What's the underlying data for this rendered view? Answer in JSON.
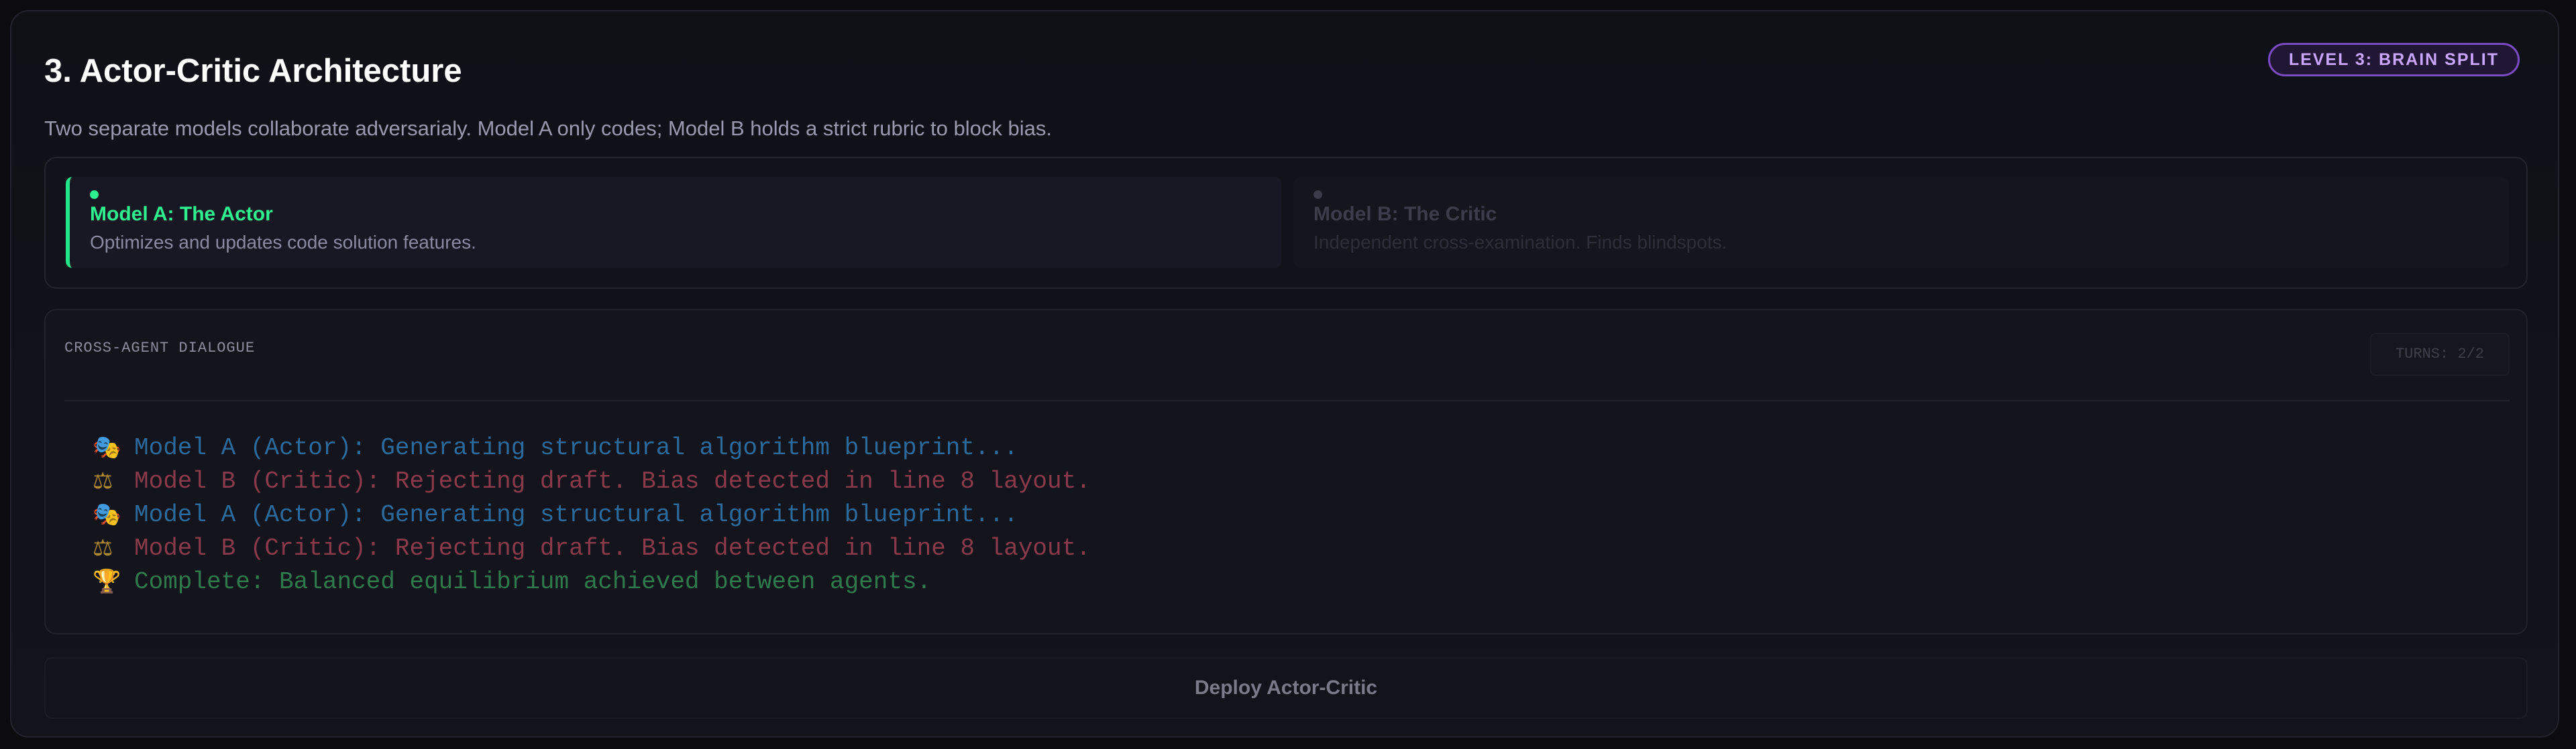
{
  "header": {
    "title": "3. Actor-Critic Architecture",
    "level_badge": "LEVEL 3: BRAIN SPLIT",
    "subtitle": "Two separate models collaborate adversarialy. Model A only codes; Model B holds a strict rubric to block bias."
  },
  "models": [
    {
      "name": "Model A: The Actor",
      "description": "Optimizes and updates code solution features.",
      "status": "active",
      "accent": "#2ef08f"
    },
    {
      "name": "Model B: The Critic",
      "description": "Independent cross-examination. Finds blindspots.",
      "status": "inactive",
      "accent": "#3a3a48"
    }
  ],
  "dialogue": {
    "label": "CROSS-AGENT DIALOGUE",
    "turns": "TURNS: 2/2",
    "lines": [
      {
        "icon": "🎭",
        "icon_name": "theater-masks-icon",
        "kind": "actor",
        "text": "Model A (Actor): Generating structural algorithm blueprint..."
      },
      {
        "icon": "⚖",
        "icon_name": "scales-icon",
        "kind": "critic",
        "text": "Model B (Critic): Rejecting draft. Bias detected in line 8 layout."
      },
      {
        "icon": "🎭",
        "icon_name": "theater-masks-icon",
        "kind": "actor",
        "text": "Model A (Actor): Generating structural algorithm blueprint..."
      },
      {
        "icon": "⚖",
        "icon_name": "scales-icon",
        "kind": "critic",
        "text": "Model B (Critic): Rejecting draft. Bias detected in line 8 layout."
      },
      {
        "icon": "🏆",
        "icon_name": "trophy-icon",
        "kind": "complete",
        "text": "Complete: Balanced equilibrium achieved between agents."
      }
    ]
  },
  "actions": {
    "deploy_label": "Deploy Actor-Critic"
  },
  "colors": {
    "background": "#0b0b10",
    "panel": "#12121a",
    "active_green": "#2ef08f",
    "badge_purple": "#c9a6ff",
    "actor_blue": "#2a6a9c",
    "critic_red": "#8a3a4a",
    "complete_green": "#2f7a4c"
  }
}
